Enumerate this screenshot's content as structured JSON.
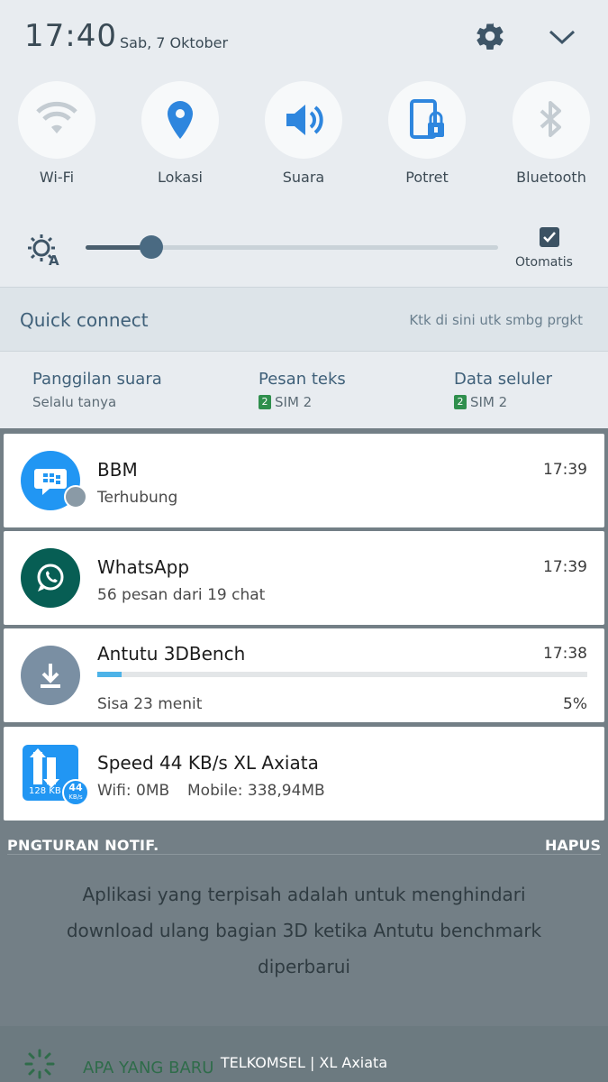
{
  "status": {
    "time": "17:40",
    "date": "Sab, 7 Oktober"
  },
  "quick_settings": [
    {
      "label": "Wi-Fi",
      "icon": "wifi-icon"
    },
    {
      "label": "Lokasi",
      "icon": "location-icon"
    },
    {
      "label": "Suara",
      "icon": "sound-icon"
    },
    {
      "label": "Potret",
      "icon": "portrait-lock-icon"
    },
    {
      "label": "Bluetooth",
      "icon": "bluetooth-icon"
    }
  ],
  "brightness": {
    "level": 0.16,
    "auto_label": "Otomatis",
    "auto_checked": true
  },
  "quick_connect": {
    "title": "Quick connect",
    "hint": "Ktk di sini utk smbg prgkt"
  },
  "sim_settings": [
    {
      "title": "Panggilan suara",
      "value": "Selalu tanya",
      "sim": ""
    },
    {
      "title": "Pesan teks",
      "value": "SIM 2",
      "sim": "2"
    },
    {
      "title": "Data seluler",
      "value": "SIM 2",
      "sim": "2"
    }
  ],
  "notifications": [
    {
      "app": "BBM",
      "text": "Terhubung",
      "time": "17:39",
      "icon_color": "#2196f3"
    },
    {
      "app": "WhatsApp",
      "text": "56 pesan dari 19 chat",
      "time": "17:39",
      "icon_color": "#075e54"
    },
    {
      "app": "Antutu 3DBench",
      "text": "Sisa 23 menit",
      "time": "17:38",
      "progress": 0.05,
      "progress_label": "5%",
      "icon_color": "#7a8fa3"
    },
    {
      "app": "Speed 44 KB/s XL Axiata",
      "text_wifi": "Wifi: 0MB",
      "text_mobile": "Mobile: 338,94MB",
      "icon_top": "128 KB",
      "icon_badge_value": "44",
      "icon_badge_unit": "KB/s"
    }
  ],
  "actions": {
    "settings_label": "PNGTURAN NOTIF.",
    "clear_label": "HAPUS"
  },
  "background_text": "Aplikasi yang terpisah adalah untuk menghindari download ulang bagian 3D ketika Antutu benchmark diperbarui",
  "bottom": {
    "new_label": "APA YANG BARU",
    "carrier": "TELKOMSEL | XL Axiata"
  }
}
